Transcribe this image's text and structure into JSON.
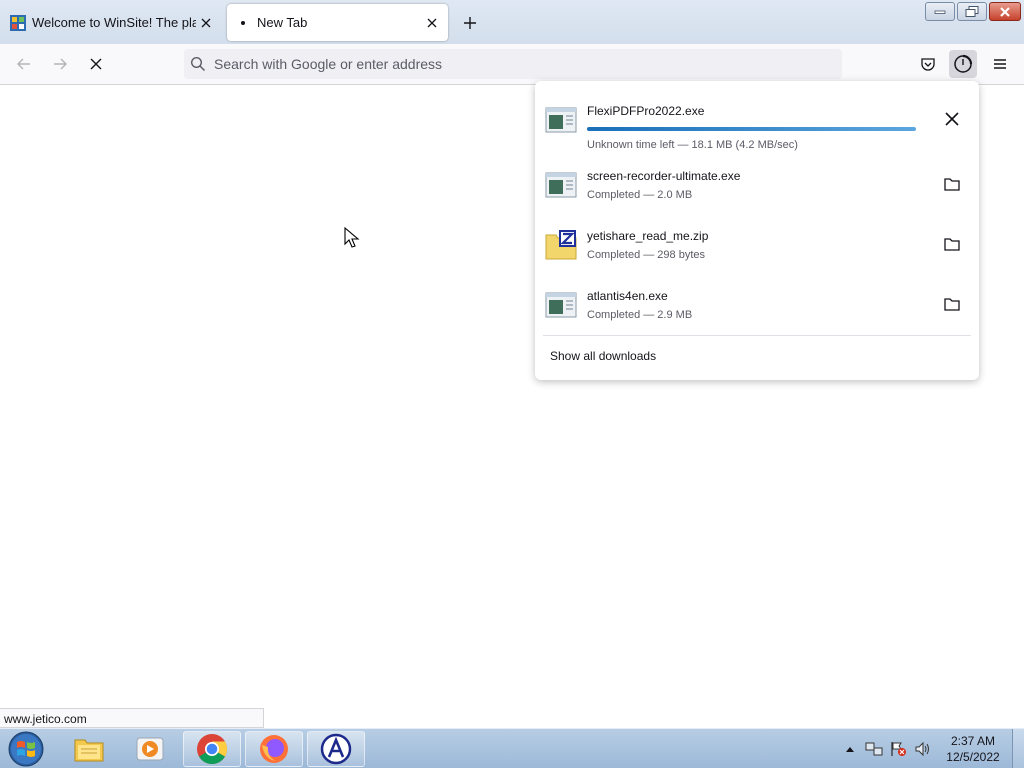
{
  "tabs": [
    {
      "label": "Welcome to WinSite! The place",
      "active": false
    },
    {
      "label": "New Tab",
      "active": true
    }
  ],
  "navbar": {
    "search_placeholder": "Search with Google or enter address"
  },
  "downloads": {
    "items": [
      {
        "name": "FlexiPDFPro2022.exe",
        "status": "Unknown time left — 18.1 MB (4.2 MB/sec)",
        "icon": "exe-icon",
        "progress": 1.0,
        "in_progress": true
      },
      {
        "name": "screen-recorder-ultimate.exe",
        "status": "Completed — 2.0 MB",
        "icon": "exe-icon"
      },
      {
        "name": "yetishare_read_me.zip",
        "status": "Completed — 298 bytes",
        "icon": "zip-icon"
      },
      {
        "name": "atlantis4en.exe",
        "status": "Completed — 2.9 MB",
        "icon": "exe-icon"
      }
    ],
    "show_all_label": "Show all downloads"
  },
  "status_link": "www.jetico.com",
  "taskbar": {
    "time": "2:37 AM",
    "date": "12/5/2022"
  },
  "colors": {
    "progress": "#1a6fb8",
    "taskbar": "#9db9d8"
  }
}
